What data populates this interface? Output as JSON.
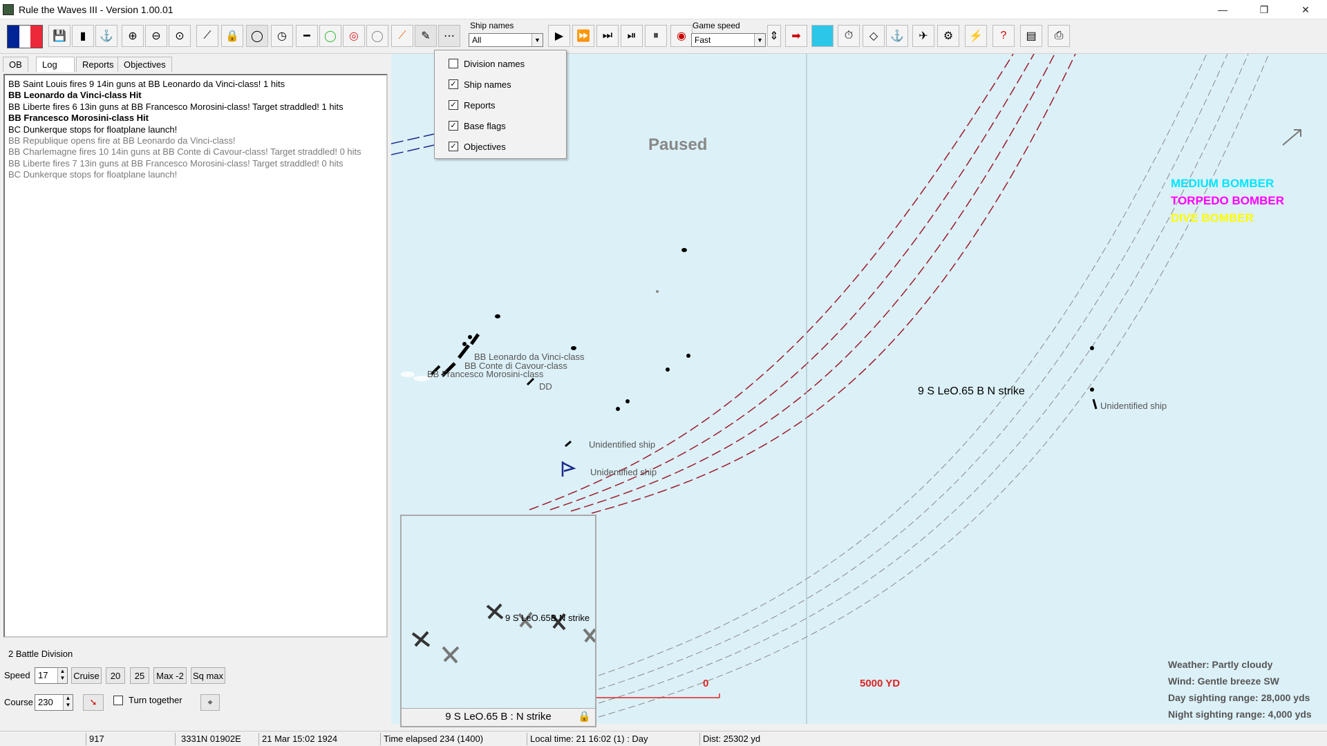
{
  "window": {
    "title": "Rule the Waves III - Version 1.00.01",
    "minimize": "—",
    "restore": "❐",
    "close": "✕"
  },
  "toolbar": {
    "flag_colors": [
      "#002395",
      "#ffffff",
      "#ed2939"
    ],
    "ship_names_label": "Ship names",
    "ship_names_value": "All",
    "game_speed_label": "Game speed",
    "game_speed_value": "Fast",
    "icons": [
      "save-icon",
      "report-icon",
      "fleet-icon",
      "zoom-in-icon",
      "zoom-out-icon",
      "zoom-fit-icon",
      "gun-icon",
      "lock-icon",
      "range-ring-icon",
      "clock-ring-icon",
      "line-icon",
      "green-ring-icon",
      "red-target-icon",
      "grey-ring-icon",
      "orange-line-icon",
      "pen-icon",
      "dots-icon",
      "step-play-1",
      "step-play-2",
      "step-play-3",
      "step-play-4",
      "pause-icon",
      "record-icon",
      "red-arrow-icon",
      "seascape-icon",
      "stopwatch-icon",
      "book-icon",
      "anchor-icon",
      "aircraft-icon",
      "aircraft-settings-icon",
      "lightning-icon",
      "help-icon",
      "torpedo-icon",
      "print-icon"
    ]
  },
  "tabs": [
    "OB",
    "Log",
    "Reports",
    "Objectives"
  ],
  "active_tab": "Log",
  "log": [
    {
      "text": "BB Saint Louis fires 9 14in guns at BB Leonardo da Vinci-class! 1 hits",
      "style": "normal"
    },
    {
      "text": "BB Leonardo da Vinci-class Hit",
      "style": "bold"
    },
    {
      "text": "BB Liberte fires 6 13in guns at BB Francesco Morosini-class! Target straddled!  1 hits",
      "style": "normal"
    },
    {
      "text": "BB Francesco Morosini-class Hit",
      "style": "bold"
    },
    {
      "text": "BC Dunkerque stops for floatplane launch!",
      "style": "normal"
    },
    {
      "text": "BB Republique opens fire at BB Leonardo da Vinci-class!",
      "style": "grey"
    },
    {
      "text": "BB Charlemagne fires 10 14in guns at BB Conte di Cavour-class! Target straddled!  0 hits",
      "style": "grey"
    },
    {
      "text": "BB Liberte fires 7 13in guns at BB Francesco Morosini-class! Target straddled!  0 hits",
      "style": "grey"
    },
    {
      "text": "BC Dunkerque stops for floatplane launch!",
      "style": "grey"
    }
  ],
  "division": {
    "name": "2 Battle Division",
    "speed_label": "Speed",
    "speed_value": "17",
    "speed_buttons": [
      "Cruise",
      "20",
      "25",
      "Max -2",
      "Sq max"
    ],
    "course_label": "Course",
    "course_value": "230",
    "turn_together": "Turn together"
  },
  "popup_menu": [
    {
      "label": "Division names",
      "checked": false
    },
    {
      "label": "Ship names",
      "checked": true
    },
    {
      "label": "Reports",
      "checked": true
    },
    {
      "label": "Base flags",
      "checked": true
    },
    {
      "label": "Objectives",
      "checked": true
    }
  ],
  "map": {
    "paused": "Paused",
    "legend": [
      {
        "label": "MEDIUM BOMBER",
        "color": "#00e5ff"
      },
      {
        "label": "TORPEDO BOMBER",
        "color": "#ff00ff"
      },
      {
        "label": "DIVE BOMBER",
        "color": "#ffff00"
      }
    ],
    "ship_labels": {
      "leonardo": "BB Leonardo da Vinci-class",
      "conte": "BB Conte di Cavour-class",
      "morosini": "BB Francesco Morosini-class",
      "dd": "DD",
      "unid1": "Unidentified ship",
      "unid2": "Unidentified ship",
      "unid3": "Unidentified ship"
    },
    "strike_label": "9 S LeO.65 B N strike",
    "scale_zero": "0",
    "scale_label": "5000 YD",
    "weather": "Weather: Partly cloudy",
    "wind": "Wind: Gentle breeze  SW",
    "day_range": "Day sighting range: 28,000 yds",
    "night_range": "Night sighting range: 4,000 yds"
  },
  "minimap": {
    "plane_label": "9 S LeO.65B N strike",
    "title": "9 S LeO.65 B : N strike"
  },
  "status": {
    "turn": "917",
    "position": "3331N 01902E",
    "date": "21 Mar 15:02 1924",
    "elapsed": "Time elapsed 234 (1400)",
    "local_time": "Local time: 21 16:02 (1) : Day",
    "dist": "Dist: 25302 yd"
  }
}
